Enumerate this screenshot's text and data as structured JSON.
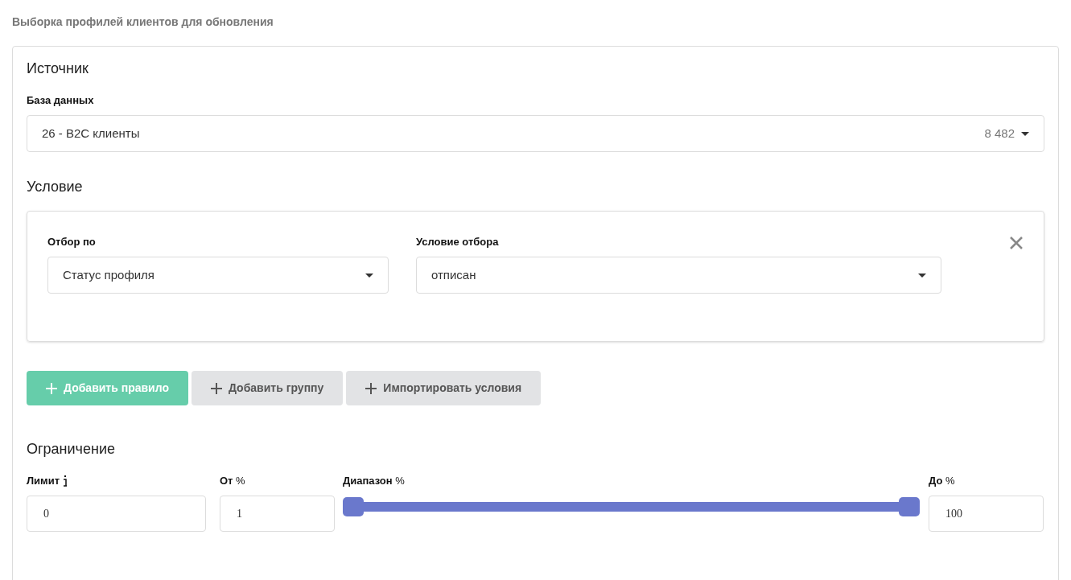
{
  "page_title": "Выборка профилей клиентов для обновления",
  "source": {
    "heading": "Источник",
    "database": {
      "label": "База данных",
      "value": "26 - B2C клиенты",
      "count": "8 482"
    }
  },
  "condition": {
    "heading": "Условие",
    "rules": [
      {
        "filter_by": {
          "label": "Отбор по",
          "value": "Статус профиля"
        },
        "filter_condition": {
          "label": "Условие отбора",
          "value": "отписан"
        }
      }
    ],
    "buttons": [
      {
        "kind": "primary",
        "label": "Добавить правило"
      },
      {
        "kind": "secondary",
        "label": "Добавить группу"
      },
      {
        "kind": "secondary",
        "label": "Импортировать условия"
      }
    ]
  },
  "limit": {
    "heading": "Ограничение",
    "limit_field": {
      "label": "Лимит",
      "value": "0"
    },
    "from_field": {
      "label": "**От** %",
      "value": "1"
    },
    "range": {
      "label": "**Диапазон** %",
      "thumbs": [
        {
          "level": 0
        },
        {
          "level": 1
        }
      ]
    },
    "to_field": {
      "label": "**До** %",
      "value": "100"
    }
  }
}
